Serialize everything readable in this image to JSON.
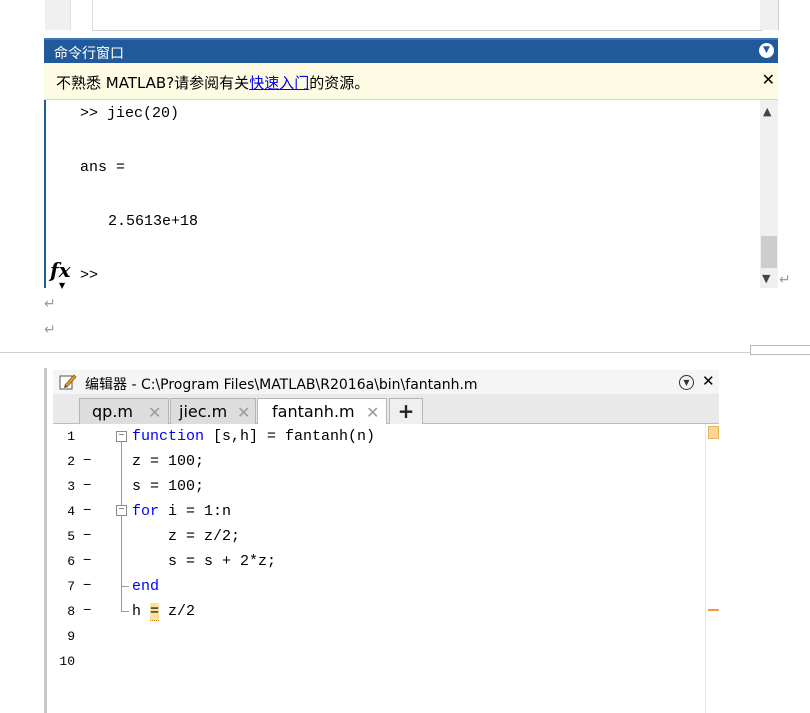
{
  "command_window": {
    "title": "命令行窗口",
    "collapse_icon": "chevron-down-circle",
    "notice": {
      "prefix": "不熟悉 MATLAB?请参阅有关",
      "link": "快速入门",
      "suffix": "的资源。",
      "close": "✕"
    },
    "lines": [
      ">> jiec(20)",
      "ans =",
      "2.5613e+18",
      ">>"
    ],
    "fx_label": "fx",
    "scroll_up": "⌃",
    "scroll_down": "⌄"
  },
  "doc_marks": {
    "return_glyph": "↵"
  },
  "editor": {
    "title": "编辑器 - C:\\Program Files\\MATLAB\\R2016a\\bin\\fantanh.m",
    "close": "✕",
    "tabs": [
      {
        "label": "qp.m",
        "close": "✕",
        "active": false
      },
      {
        "label": "jiec.m",
        "close": "✕",
        "active": false
      },
      {
        "label": "fantanh.m",
        "close": "✕",
        "active": true
      }
    ],
    "add_tab": "+",
    "line_numbers": [
      "1",
      "2",
      "3",
      "4",
      "5",
      "6",
      "7",
      "8",
      "9",
      "10"
    ],
    "code": {
      "l1_kw": "function",
      "l1_rest": " [s,h] = fantanh(n)",
      "l2": "z = 100;",
      "l3": "s = 100;",
      "l4_kw": "for",
      "l4_rest": " i = 1:n",
      "l5": "z = z/2;",
      "l6": "s = s + 2*z;",
      "l7_kw": "end",
      "l8_a": "h ",
      "l8_eq": "=",
      "l8_b": " z/2"
    },
    "fold_glyph": "−",
    "warning_color": "#f29b3a"
  }
}
